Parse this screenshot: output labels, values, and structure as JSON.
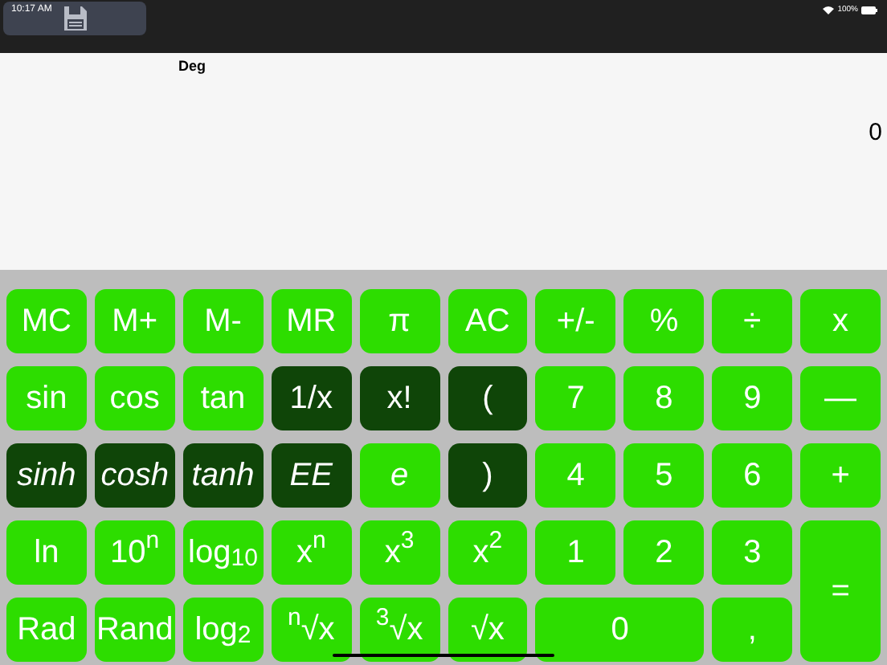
{
  "status_bar": {
    "time": "10:17 AM",
    "battery": "100%"
  },
  "display": {
    "mode": "Deg",
    "value": "0"
  },
  "keys": [
    {
      "label": "MC",
      "dark": false,
      "italic": false,
      "kind": "key"
    },
    {
      "label": "M+",
      "dark": false,
      "italic": false,
      "kind": "key"
    },
    {
      "label": "M-",
      "dark": false,
      "italic": false,
      "kind": "key"
    },
    {
      "label": "MR",
      "dark": false,
      "italic": false,
      "kind": "key"
    },
    {
      "label": "π",
      "dark": false,
      "italic": false,
      "kind": "key"
    },
    {
      "label": "AC",
      "dark": false,
      "italic": false,
      "kind": "key"
    },
    {
      "label": "+/-",
      "dark": false,
      "italic": false,
      "kind": "key"
    },
    {
      "label": "%",
      "dark": false,
      "italic": false,
      "kind": "key"
    },
    {
      "label": "÷",
      "dark": false,
      "italic": false,
      "kind": "key"
    },
    {
      "label": "x",
      "dark": false,
      "italic": false,
      "kind": "key"
    },
    {
      "label": "sin",
      "dark": false,
      "italic": false,
      "kind": "key"
    },
    {
      "label": "cos",
      "dark": false,
      "italic": false,
      "kind": "key"
    },
    {
      "label": "tan",
      "dark": false,
      "italic": false,
      "kind": "key"
    },
    {
      "label": "1/x",
      "dark": true,
      "italic": false,
      "kind": "key"
    },
    {
      "label": "x!",
      "dark": true,
      "italic": false,
      "kind": "key"
    },
    {
      "label": "(",
      "dark": true,
      "italic": false,
      "kind": "key"
    },
    {
      "label": "7",
      "dark": false,
      "italic": false,
      "kind": "key"
    },
    {
      "label": "8",
      "dark": false,
      "italic": false,
      "kind": "key"
    },
    {
      "label": "9",
      "dark": false,
      "italic": false,
      "kind": "key"
    },
    {
      "label": "—",
      "dark": false,
      "italic": false,
      "kind": "key"
    },
    {
      "label": "sinh",
      "dark": true,
      "italic": true,
      "kind": "key"
    },
    {
      "label": "cosh",
      "dark": true,
      "italic": true,
      "kind": "key"
    },
    {
      "label": "tanh",
      "dark": true,
      "italic": true,
      "kind": "key"
    },
    {
      "label": "EE",
      "dark": true,
      "italic": true,
      "kind": "key"
    },
    {
      "label": "e",
      "dark": false,
      "italic": true,
      "kind": "key"
    },
    {
      "label": ")",
      "dark": true,
      "italic": false,
      "kind": "key"
    },
    {
      "label": "4",
      "dark": false,
      "italic": false,
      "kind": "key"
    },
    {
      "label": "5",
      "dark": false,
      "italic": false,
      "kind": "key"
    },
    {
      "label": "6",
      "dark": false,
      "italic": false,
      "kind": "key"
    },
    {
      "label": "+",
      "dark": false,
      "italic": false,
      "kind": "key"
    },
    {
      "label": "ln",
      "dark": false,
      "italic": false,
      "kind": "key"
    },
    {
      "label": "10$^{n}$",
      "dark": false,
      "italic": false,
      "kind": "key"
    },
    {
      "label": "log$_{10}$",
      "dark": false,
      "italic": false,
      "kind": "key"
    },
    {
      "label": "x$^{n}$",
      "dark": false,
      "italic": false,
      "kind": "key"
    },
    {
      "label": "x$^{3}$",
      "dark": false,
      "italic": false,
      "kind": "key"
    },
    {
      "label": "x$^{2}$",
      "dark": false,
      "italic": false,
      "kind": "key"
    },
    {
      "label": "1",
      "dark": false,
      "italic": false,
      "kind": "key"
    },
    {
      "label": "2",
      "dark": false,
      "italic": false,
      "kind": "key"
    },
    {
      "label": "3",
      "dark": false,
      "italic": false,
      "kind": "key"
    },
    {
      "label": "=",
      "dark": false,
      "italic": false,
      "kind": "tall"
    },
    {
      "label": "Rad",
      "dark": false,
      "italic": false,
      "kind": "key"
    },
    {
      "label": "Rand",
      "dark": false,
      "italic": false,
      "kind": "key"
    },
    {
      "label": "log$_{2}$",
      "dark": false,
      "italic": false,
      "kind": "key"
    },
    {
      "label": "$^{n}$√x",
      "dark": false,
      "italic": false,
      "kind": "key"
    },
    {
      "label": "$^{3}$√x",
      "dark": false,
      "italic": false,
      "kind": "key"
    },
    {
      "label": "√x",
      "dark": false,
      "italic": false,
      "kind": "key"
    },
    {
      "label": "0",
      "dark": false,
      "italic": false,
      "kind": "wide"
    },
    {
      "label": ",",
      "dark": false,
      "italic": false,
      "kind": "key"
    }
  ]
}
